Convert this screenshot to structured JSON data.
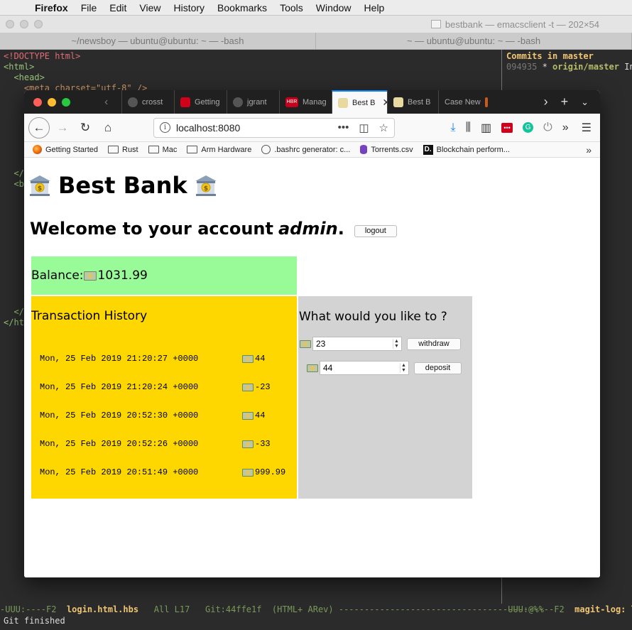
{
  "menubar": {
    "app": "Firefox",
    "items": [
      "File",
      "Edit",
      "View",
      "History",
      "Bookmarks",
      "Tools",
      "Window",
      "Help"
    ]
  },
  "terminal": {
    "title": "bestbank — emacsclient -t — 202×54",
    "tabs": [
      "~/newsboy — ubuntu@ubuntu: ~ — -bash",
      "~ — ubuntu@ubuntu: ~ — -bash"
    ],
    "code_lines": [
      "<!DOCTYPE html>",
      "<html>",
      "  <head>",
      "    <meta charset=\"utf-8\" />",
      "",
      "",
      "",
      "",
      "",
      "",
      "",
      "  </",
      "  <b",
      "",
      "",
      "",
      "",
      "",
      "",
      "",
      "",
      "",
      "",
      "",
      "  </",
      "</ht"
    ],
    "magit_header": "Commits in master",
    "magit_hash": "094935",
    "magit_branch": "origin/master",
    "magit_rest": " In",
    "modeline_left": "-UUU:----F2  ",
    "modeline_file": "login.html.hbs",
    "modeline_mid": "   All L17   Git:44ffe1f  (HTML+ ARev) ----------------------------------------",
    "modeline_right": "-UUU:@%%--F2  ",
    "modeline_right_buf": "magit-log: l",
    "minibuffer": "Git finished"
  },
  "browser": {
    "tabs": [
      {
        "label": "crosst",
        "color": "#333"
      },
      {
        "label": "Getting",
        "color": "#d0021b"
      },
      {
        "label": "jgrant",
        "color": "#333"
      },
      {
        "label": "Manag",
        "color": "#c4001a"
      },
      {
        "label": "Best B",
        "color": "#c9a227",
        "active": true
      },
      {
        "label": "Best B",
        "color": "#c9a227"
      },
      {
        "label": "Case New",
        "color": "#555"
      }
    ],
    "url": "localhost:8080",
    "bookmarks": [
      "Getting Started",
      "Rust",
      "Mac",
      "Arm Hardware",
      ".bashrc generator: c...",
      "Torrents.csv",
      "Blockchain perform..."
    ]
  },
  "page": {
    "title": "Best Bank",
    "welcome_prefix": "Welcome to your account ",
    "username": "admin",
    "welcome_suffix": ".",
    "logout_label": "logout",
    "balance_label": "Balance: ",
    "balance_value": "1031.99",
    "history_title": "Transaction History",
    "transactions": [
      {
        "date": "Mon, 25 Feb 2019 21:20:27 +0000",
        "amount": "44"
      },
      {
        "date": "Mon, 25 Feb 2019 21:20:24 +0000",
        "amount": "-23"
      },
      {
        "date": "Mon, 25 Feb 2019 20:52:30 +0000",
        "amount": "44"
      },
      {
        "date": "Mon, 25 Feb 2019 20:52:26 +0000",
        "amount": "-33"
      },
      {
        "date": "Mon, 25 Feb 2019 20:51:49 +0000",
        "amount": "999.99"
      }
    ],
    "action_title": "What would you like to ?",
    "withdraw_value": "23",
    "withdraw_label": "withdraw",
    "deposit_value": "44",
    "deposit_label": "deposit"
  },
  "colors": {
    "balance_bg": "#98fb98",
    "history_bg": "#ffd700",
    "action_bg": "#d3d3d3",
    "accent": "#0a84ff"
  }
}
